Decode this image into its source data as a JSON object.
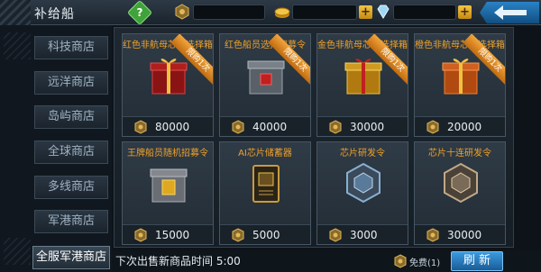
{
  "header": {
    "title": "补给船",
    "gold_value": "",
    "diamond_value": "",
    "medal_value": ""
  },
  "sidebar": {
    "items": [
      {
        "label": "科技商店"
      },
      {
        "label": "远洋商店"
      },
      {
        "label": "岛屿商店"
      },
      {
        "label": "全球商店"
      },
      {
        "label": "多线商店"
      },
      {
        "label": "军港商店"
      },
      {
        "label": "全服军港商店"
      }
    ],
    "active_index": 6
  },
  "cards": [
    {
      "title": "红色非航母芯片选择箱",
      "price": "80000",
      "limited": "限购1次",
      "icon": "red-gift-box-icon"
    },
    {
      "title": "红色船员选择招募令",
      "price": "40000",
      "limited": "限购1次",
      "icon": "grey-crate-icon"
    },
    {
      "title": "金色非航母芯片选择箱",
      "price": "30000",
      "limited": "限购1次",
      "icon": "gold-gift-box-icon"
    },
    {
      "title": "橙色非航母芯片选择箱",
      "price": "20000",
      "limited": "限购1次",
      "icon": "orange-gift-box-icon"
    },
    {
      "title": "王牌船员随机招募令",
      "price": "15000",
      "limited": "",
      "icon": "gold-crate-icon"
    },
    {
      "title": "AI芯片储蓄器",
      "price": "5000",
      "limited": "",
      "icon": "chip-storage-icon"
    },
    {
      "title": "芯片研发令",
      "price": "3000",
      "limited": "",
      "icon": "chip-medal-icon"
    },
    {
      "title": "芯片十连研发令",
      "price": "30000",
      "limited": "",
      "icon": "chip-ten-medal-icon"
    }
  ],
  "bottom": {
    "refresh_text": "下次出售新商品时间 5:00",
    "free_text": "免费(1)",
    "refresh_button": "刷 新"
  },
  "colors": {
    "accent_orange": "#f0a22a",
    "refresh_blue": "#3a9ae0",
    "gold": "#f3c544"
  }
}
